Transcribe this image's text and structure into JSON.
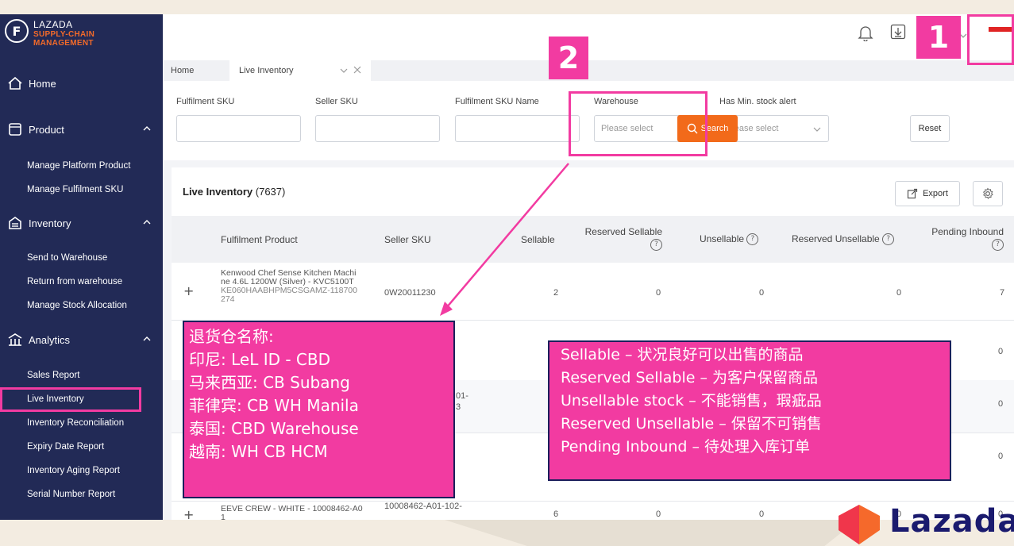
{
  "app": {
    "logo_line1": "LAZADA",
    "logo_line2": "SUPPLY-CHAIN",
    "logo_line3": "MANAGEMENT",
    "logo_letter": "F"
  },
  "sidebar": {
    "home": "Home",
    "product": "Product",
    "product_items": [
      "Manage Platform Product",
      "Manage Fulfilment SKU"
    ],
    "inventory": "Inventory",
    "inventory_items": [
      "Send to Warehouse",
      "Return from warehouse",
      "Manage Stock Allocation"
    ],
    "analytics": "Analytics",
    "analytics_items": [
      "Sales Report",
      "Live Inventory",
      "Inventory Reconciliation",
      "Expiry Date Report",
      "Inventory Aging Report",
      "Serial Number Report"
    ]
  },
  "tabs": {
    "home": "Home",
    "live_inventory": "Live Inventory"
  },
  "filters": {
    "fulfilment_sku": "Fulfilment SKU",
    "seller_sku": "Seller SKU",
    "fulfilment_sku_name": "Fulfilment SKU Name",
    "warehouse": "Warehouse",
    "warehouse_placeholder": "Please select",
    "min_stock_alert": "Has Min. stock alert",
    "min_stock_placeholder": "Please select",
    "search": "Search",
    "reset": "Reset"
  },
  "card": {
    "title": "Live Inventory",
    "count": "(7637)",
    "export": "Export"
  },
  "table": {
    "headers": {
      "product": "Fulfilment Product",
      "seller_sku": "Seller SKU",
      "sellable": "Sellable",
      "reserved_sellable": "Reserved Sellable",
      "unsellable": "Unsellable",
      "reserved_unsellable": "Reserved Unsellable",
      "pending_inbound": "Pending Inbound"
    },
    "qmark": "?",
    "row1": {
      "product_line1": "Kenwood Chef Sense Kitchen Machi",
      "product_line2": "ne 4.6L 1200W (Silver) - KVC5100T",
      "product_code1": "KE060HAABHPM5CSGAMZ-118700",
      "product_code2": "274",
      "seller_sku": "0W20011230",
      "sellable": "2",
      "reserved_sellable": "0",
      "unsellable": "0",
      "reserved_unsellable": "0",
      "pending_inbound": "7"
    },
    "row2": {
      "pending_inbound": "0"
    },
    "row3": {
      "seller_sku_frag1": "01-",
      "seller_sku_frag2": "3",
      "pending_inbound": "0"
    },
    "row4": {
      "pending_inbound": "0"
    },
    "row5": {
      "product_line1": "EEVE CREW - WHITE - 10008462-A0",
      "product_line2": "1",
      "seller_sku": "10008462-A01-102-",
      "sellable": "6",
      "reserved_sellable": "0",
      "unsellable": "0",
      "reserved_unsellable": "0",
      "pending_inbound": "0"
    }
  },
  "annotations": {
    "badge1": "1",
    "badge2": "2",
    "warehouse_note": [
      "退货仓名称:",
      "印尼: LeL ID -  CBD",
      "马来西亚: CB Subang",
      "菲律宾: CB WH Manila",
      "泰国: CBD Warehouse",
      "越南: WH CB HCM"
    ],
    "stock_note": [
      "Sellable  – 状况良好可以出售的商品",
      "Reserved Sellable – 为客户保留商品",
      "Unsellable stock – 不能销售，瑕疵品",
      "Reserved Unsellable – 保留不可销售",
      "Pending Inbound  – 待处理入库订单"
    ],
    "brand": "Lazada"
  },
  "colors": {
    "sidebar": "#222a56",
    "accent": "#f23ba1",
    "search_button": "#f26a1a",
    "slide_background": "#f3ece1"
  }
}
